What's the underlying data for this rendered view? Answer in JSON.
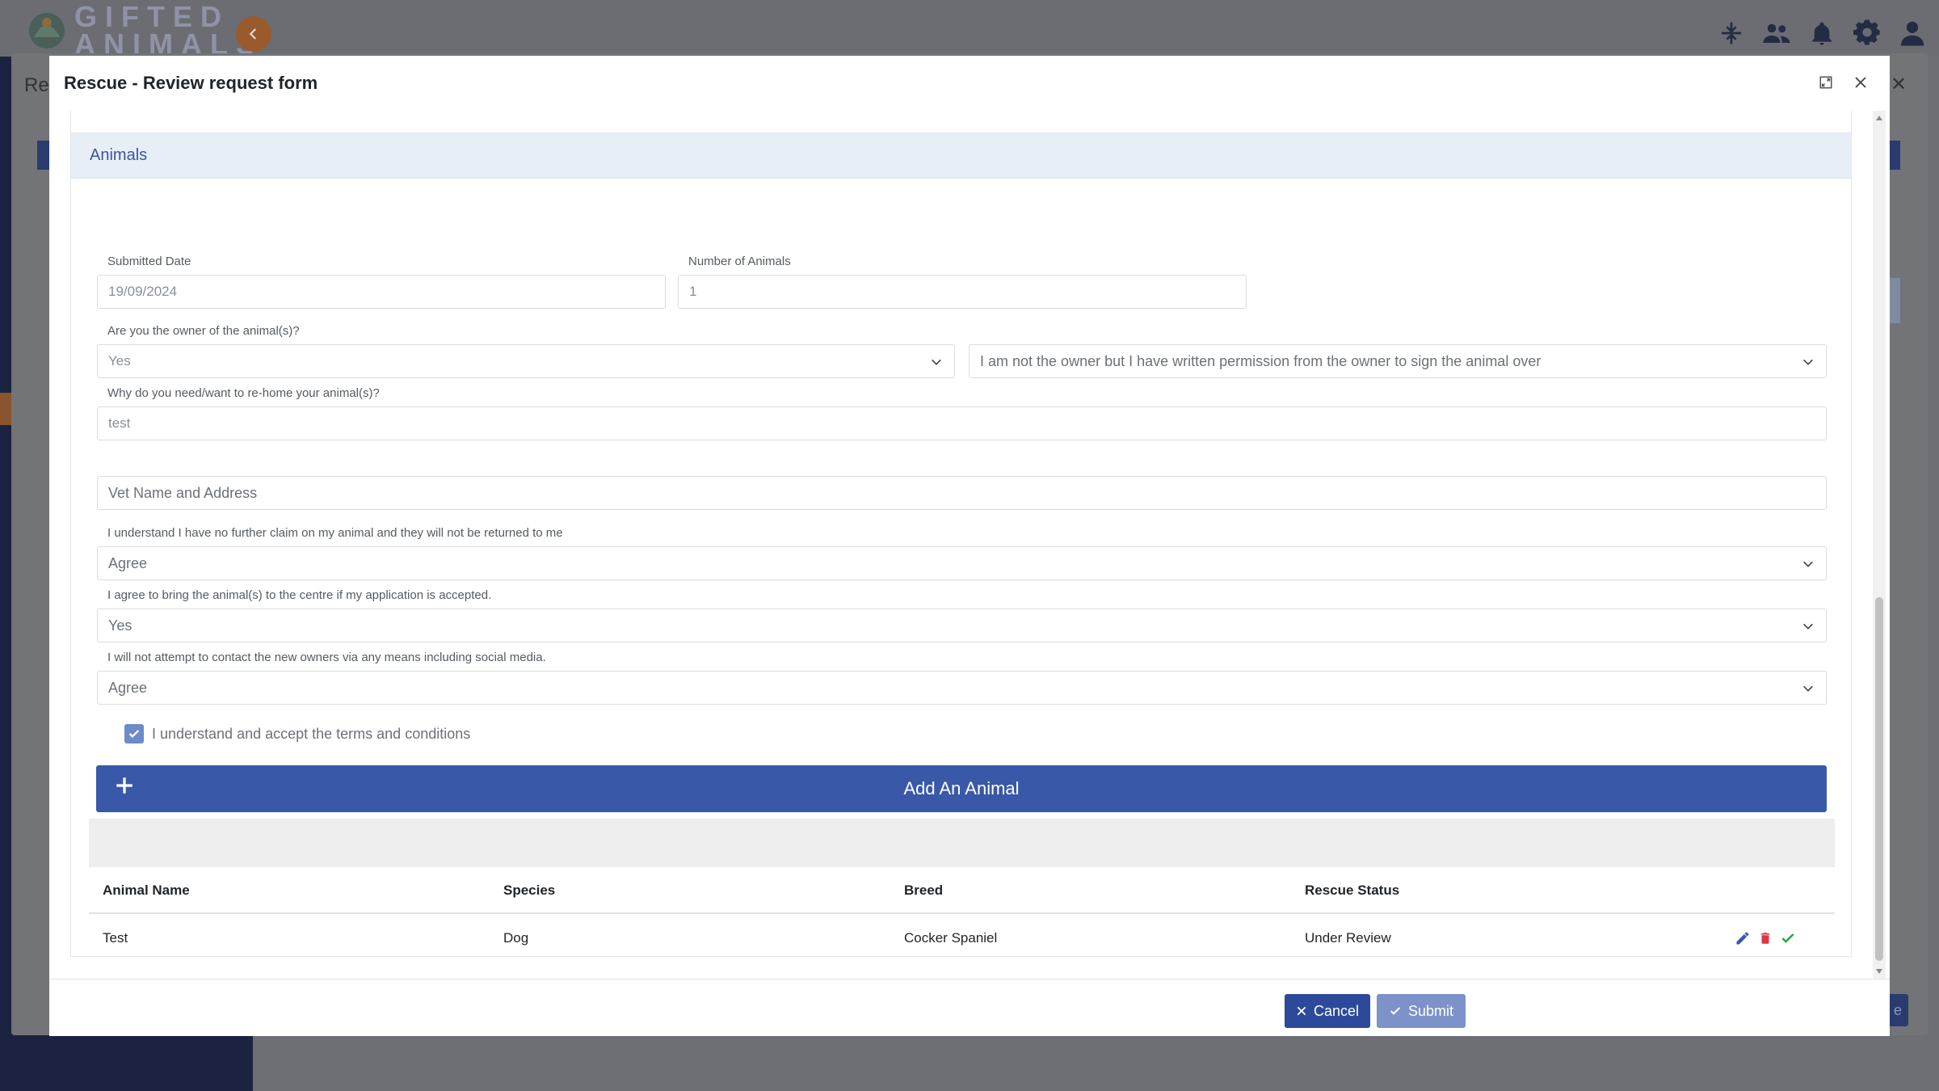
{
  "app": {
    "brand_line1": "GIFTED",
    "brand_line2": "ANIMALS",
    "page_fragment": "Res"
  },
  "modal": {
    "title": "Rescue - Review request form",
    "section_title": "Animals",
    "fields": {
      "submitted_date": {
        "label": "Submitted Date",
        "value": "19/09/2024"
      },
      "number_of_animals": {
        "label": "Number of Animals",
        "value": "1"
      },
      "owner": {
        "label": "Are you the owner of the animal(s)?",
        "value": "Yes"
      },
      "owner_detail": {
        "value": "I am not the owner but I have written permission from the owner to sign the animal over"
      },
      "rehome_reason": {
        "label": "Why do you need/want to re-home your animal(s)?",
        "value": "test"
      },
      "vet": {
        "placeholder": "Vet Name and Address"
      },
      "no_further_claim": {
        "label": "I understand I have no further claim on my animal and they will not be returned to me",
        "value": "Agree"
      },
      "bring_to_centre": {
        "label": "I agree to bring the animal(s) to the centre if my application is accepted.",
        "value": "Yes"
      },
      "no_contact": {
        "label": "I will not attempt to contact the new owners via any means including social media.",
        "value": "Agree"
      }
    },
    "terms_label": "I understand and accept the terms and conditions",
    "add_animal_label": "Add An Animal",
    "table": {
      "headers": [
        "Animal Name",
        "Species",
        "Breed",
        "Rescue Status"
      ],
      "rows": [
        {
          "name": "Test",
          "species": "Dog",
          "breed": "Cocker Spaniel",
          "status": "Under Review"
        }
      ]
    },
    "footer": {
      "cancel_label": "Cancel",
      "submit_label": "Submit"
    }
  },
  "colors": {
    "primary": "#3a58a8",
    "section_bg": "#e8eef6",
    "edit": "#3a58a8",
    "delete": "#dc3545",
    "approve": "#28a745"
  }
}
